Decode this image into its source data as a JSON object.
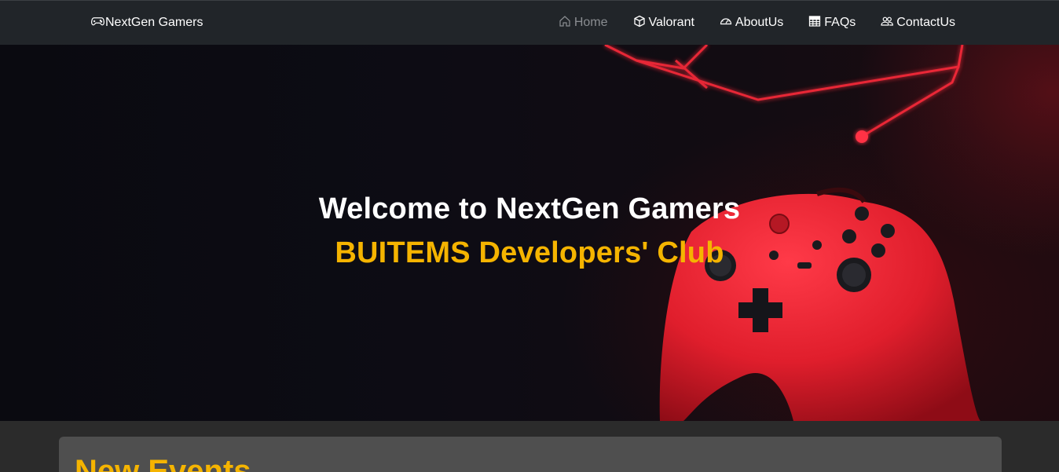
{
  "navbar": {
    "brand": {
      "icon": "gamepad-icon",
      "label": "NextGen Gamers"
    },
    "links": [
      {
        "icon": "house-icon",
        "label": "Home",
        "active": true
      },
      {
        "icon": "box-icon",
        "label": "Valorant",
        "active": false
      },
      {
        "icon": "speedometer-icon",
        "label": "AboutUs",
        "active": false
      },
      {
        "icon": "table-icon",
        "label": "FAQs",
        "active": false
      },
      {
        "icon": "people-icon",
        "label": "ContactUs",
        "active": false
      }
    ]
  },
  "hero": {
    "title": "Welcome to NextGen Gamers",
    "subtitle": "BUITEMS Developers' Club"
  },
  "events": {
    "title": "New Events"
  },
  "colors": {
    "navbar_bg": "#212529",
    "accent": "#f5b400",
    "active_link": "#8a8d91",
    "card_bg": "#4f4f4f"
  }
}
